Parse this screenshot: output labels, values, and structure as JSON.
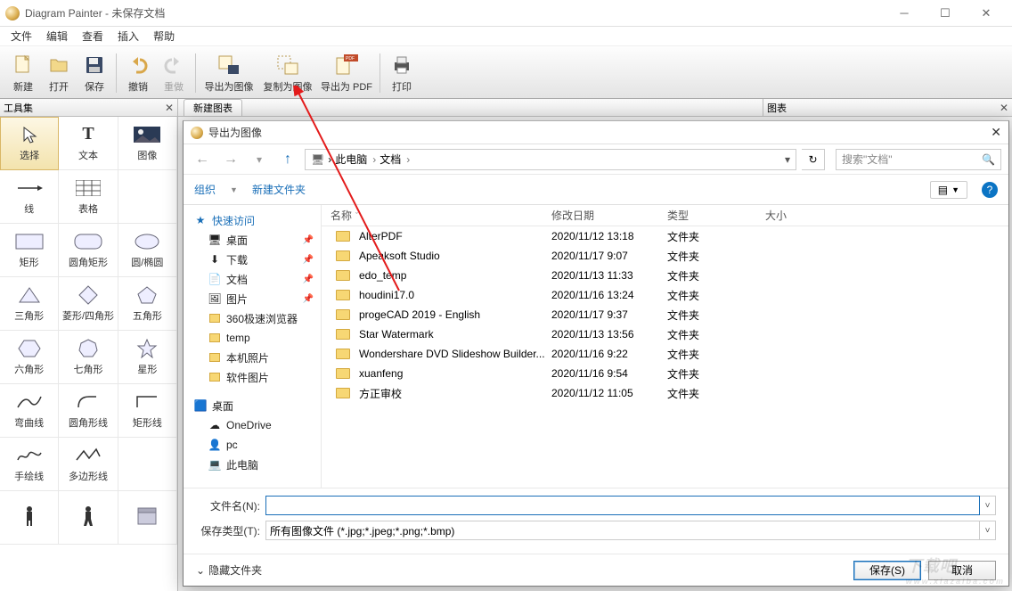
{
  "title": "Diagram Painter - 未保存文档",
  "menus": [
    "文件",
    "编辑",
    "查看",
    "插入",
    "帮助"
  ],
  "toolbar": {
    "new": "新建",
    "open": "打开",
    "save": "保存",
    "undo": "撤销",
    "redo": "重做",
    "export_img": "导出为图像",
    "copy_img": "复制为图像",
    "export_pdf": "导出为 PDF",
    "print": "打印"
  },
  "sidebar": {
    "title": "工具集",
    "tools": [
      {
        "id": "select",
        "label": "选择"
      },
      {
        "id": "text",
        "label": "文本"
      },
      {
        "id": "image",
        "label": "图像"
      },
      {
        "id": "line",
        "label": "线"
      },
      {
        "id": "table",
        "label": "表格"
      },
      {
        "id": "blank1",
        "label": ""
      },
      {
        "id": "rect",
        "label": "矩形"
      },
      {
        "id": "roundrect",
        "label": "圆角矩形"
      },
      {
        "id": "ellipse",
        "label": "圆/椭圆"
      },
      {
        "id": "triangle",
        "label": "三角形"
      },
      {
        "id": "diamond",
        "label": "菱形/四角形"
      },
      {
        "id": "pentagon",
        "label": "五角形"
      },
      {
        "id": "hexagon",
        "label": "六角形"
      },
      {
        "id": "heptagon",
        "label": "七角形"
      },
      {
        "id": "star",
        "label": "星形"
      },
      {
        "id": "curve",
        "label": "弯曲线"
      },
      {
        "id": "rcurve",
        "label": "圆角形线"
      },
      {
        "id": "rline",
        "label": "矩形线"
      },
      {
        "id": "freehand",
        "label": "手绘线"
      },
      {
        "id": "polyline",
        "label": "多边形线"
      },
      {
        "id": "blank2",
        "label": ""
      },
      {
        "id": "person1",
        "label": ""
      },
      {
        "id": "person2",
        "label": ""
      },
      {
        "id": "server",
        "label": ""
      }
    ]
  },
  "tabs": {
    "new_chart": "新建图表"
  },
  "right_panel": {
    "title": "图表"
  },
  "dialog": {
    "title": "导出为图像",
    "breadcrumb": [
      "此电脑",
      "文档"
    ],
    "search_placeholder": "搜索\"文档\"",
    "organize": "组织",
    "new_folder": "新建文件夹",
    "tree": [
      {
        "type": "root",
        "label": "快速访问",
        "icon": "star"
      },
      {
        "type": "pin",
        "label": "桌面",
        "icon": "desktop"
      },
      {
        "type": "pin",
        "label": "下载",
        "icon": "download"
      },
      {
        "type": "pin",
        "label": "文档",
        "icon": "doc"
      },
      {
        "type": "pin",
        "label": "图片",
        "icon": "pic"
      },
      {
        "type": "sub",
        "label": "360极速浏览器"
      },
      {
        "type": "sub",
        "label": "temp"
      },
      {
        "type": "sub",
        "label": "本机照片"
      },
      {
        "type": "sub",
        "label": "软件图片"
      },
      {
        "type": "root2",
        "label": "桌面",
        "icon": "desktop-blue"
      },
      {
        "type": "sub2",
        "label": "OneDrive",
        "icon": "cloud"
      },
      {
        "type": "sub2",
        "label": "pc",
        "icon": "user"
      },
      {
        "type": "sub2",
        "label": "此电脑",
        "icon": "pc"
      }
    ],
    "columns": {
      "name": "名称",
      "date": "修改日期",
      "type": "类型",
      "size": "大小"
    },
    "rows": [
      {
        "name": "AlterPDF",
        "date": "2020/11/12 13:18",
        "type": "文件夹"
      },
      {
        "name": "Apeaksoft Studio",
        "date": "2020/11/17 9:07",
        "type": "文件夹"
      },
      {
        "name": "edo_temp",
        "date": "2020/11/13 11:33",
        "type": "文件夹"
      },
      {
        "name": "houdini17.0",
        "date": "2020/11/16 13:24",
        "type": "文件夹"
      },
      {
        "name": "progeCAD 2019 - English",
        "date": "2020/11/17 9:37",
        "type": "文件夹"
      },
      {
        "name": "Star Watermark",
        "date": "2020/11/13 13:56",
        "type": "文件夹"
      },
      {
        "name": "Wondershare DVD Slideshow Builder...",
        "date": "2020/11/16 9:22",
        "type": "文件夹"
      },
      {
        "name": "xuanfeng",
        "date": "2020/11/16 9:54",
        "type": "文件夹"
      },
      {
        "name": "方正审校",
        "date": "2020/11/12 11:05",
        "type": "文件夹"
      }
    ],
    "filename_label": "文件名(N):",
    "filetype_label": "保存类型(T):",
    "filetype_value": "所有图像文件 (*.jpg;*.jpeg;*.png;*.bmp)",
    "hide_folders": "隐藏文件夹",
    "save_btn": "保存(S)",
    "cancel_btn": "取消"
  },
  "watermark": {
    "big": "下载吧",
    "small": "www.xiazaiba.com"
  }
}
